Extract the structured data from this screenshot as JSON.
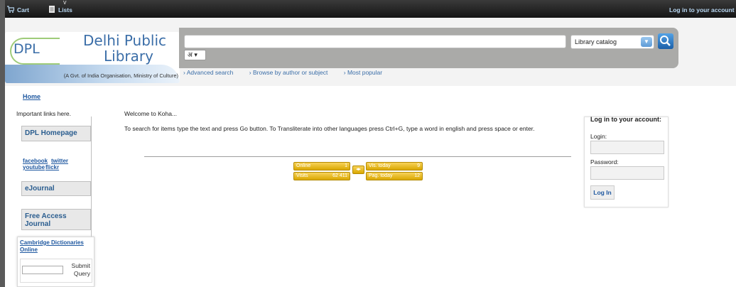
{
  "topbar": {
    "cart": "Cart",
    "lists": "Lists",
    "login": "Log in to your account",
    "caret": "v"
  },
  "logo": {
    "dpl": "DPL",
    "line1": "Delhi Public",
    "line2": "Library",
    "subtitle": "(A Gvt. of India Organisation, Ministry of Culture)"
  },
  "search": {
    "value": "",
    "lang": "अ",
    "catalog": "Library catalog",
    "advanced": "Advanced search",
    "browse": "Browse by author or subject",
    "popular": "Most popular"
  },
  "breadcrumb": {
    "home": "Home"
  },
  "sidebar": {
    "note": "Important links here.",
    "dpl_home": "DPL Homepage",
    "facebook": "facebook",
    "twitter": "twitter",
    "youtube": "youtube",
    "flickr": "flickr",
    "ejournal": "eJournal",
    "free_access": "Free Access Journal",
    "cambridge": "Cambridge Dictionaries Online",
    "submit": "Submit Query"
  },
  "main": {
    "welcome": "Welcome to Koha...",
    "instructions": "To search for items type the text and press Go button. To Transliterate into other languages press Ctrl+G, type a word in english and press space or enter."
  },
  "stats": {
    "online_label": "Online",
    "online_value": "1",
    "visits_label": "Visits",
    "visits_value": "62 411",
    "vis_today_label": "Vis. today",
    "vis_today_value": "9",
    "pag_today_label": "Pag. today",
    "pag_today_value": "12"
  },
  "login": {
    "title": "Log in to your account:",
    "login_label": "Login:",
    "password_label": "Password:",
    "button": "Log In"
  },
  "colors": {
    "link": "#1f58a0",
    "topbar": "#1c1c1c",
    "accent": "#3b6ea8",
    "stat": "#e5b61c"
  }
}
